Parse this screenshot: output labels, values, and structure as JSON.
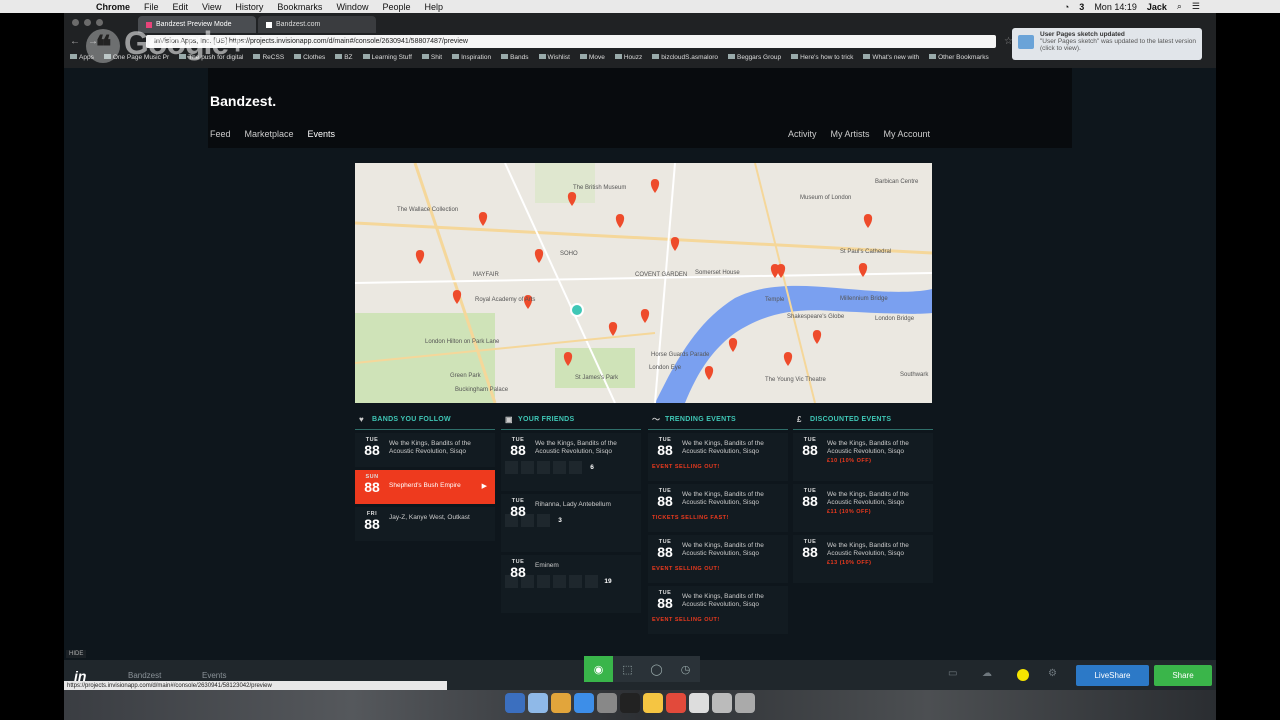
{
  "menubar": {
    "items": [
      "Chrome",
      "File",
      "Edit",
      "View",
      "History",
      "Bookmarks",
      "Window",
      "People",
      "Help"
    ],
    "clock": "Mon 14:19",
    "user": "Jack",
    "badge": "3"
  },
  "browser": {
    "tabs": [
      "Bandzest Preview Mode",
      "Bandzest.com"
    ],
    "address": "InVision Apps, Inc. [US] https://projects.invisionapp.com/d/main#/console/2630941/58807487/preview",
    "bookmarks": [
      "Apps",
      "One Page Music Pr",
      "The push for digital",
      "ReCSS",
      "Clothes",
      "BZ",
      "Learning Stuff",
      "Shit",
      "Inspiration",
      "Bands",
      "Wishlist",
      "Move",
      "Houzz",
      "bizcloudS.asmaloro",
      "Beggars Group",
      "Here's how to trick",
      "What's new with",
      "Other Bookmarks"
    ]
  },
  "overlay": {
    "gplus_text": "Google+"
  },
  "notification": {
    "title": "User Pages sketch updated",
    "body": "\"User Pages sketch\" was updated to the latest version (click to view)."
  },
  "site": {
    "logo": "Bandzest.",
    "nav_left": [
      "Feed",
      "Marketplace",
      "Events"
    ],
    "nav_right": [
      "Activity",
      "My Artists",
      "My Account"
    ]
  },
  "map_labels": [
    "The British Museum",
    "The Wallace Collection",
    "Museum of London",
    "Barbican Centre",
    "St Paul's Cathedral",
    "Millennium Bridge",
    "Shakespeare's Globe",
    "London Bridge",
    "SOHO",
    "COVENT GARDEN",
    "Somerset House",
    "MAYFAIR",
    "Royal Academy of Arts",
    "London Hilton on Park Lane",
    "Green Park",
    "Buckingham Palace",
    "St James's Park",
    "Horse Guards Parade",
    "London Eye",
    "The Young Vic Theatre",
    "Southwark",
    "Temple"
  ],
  "columns": {
    "bands": {
      "title": "BANDS YOU FOLLOW",
      "events": [
        {
          "dow": "TUE",
          "num": "88",
          "text": "We the Kings, Bandits of the Acoustic Revolution, Sisqo"
        },
        {
          "dow": "SUN",
          "num": "88",
          "text": "Shepherd's Bush Empire"
        },
        {
          "dow": "FRI",
          "num": "88",
          "text": "Jay-Z, Kanye West, Outkast"
        }
      ]
    },
    "friends": {
      "title": "YOUR FRIENDS",
      "events": [
        {
          "dow": "TUE",
          "num": "88",
          "text": "We the Kings, Bandits of the Acoustic Revolution, Sisqo",
          "count": "6"
        },
        {
          "dow": "TUE",
          "num": "88",
          "text": "Rihanna, Lady Antebellum",
          "count": "3"
        },
        {
          "dow": "TUE",
          "num": "88",
          "text": "Eminem",
          "count": "19"
        }
      ]
    },
    "trending": {
      "title": "TRENDING EVENTS",
      "events": [
        {
          "dow": "TUE",
          "num": "88",
          "text": "We the Kings, Bandits of the Acoustic Revolution, Sisqo",
          "status": "EVENT SELLING OUT!"
        },
        {
          "dow": "TUE",
          "num": "88",
          "text": "We the Kings, Bandits of the Acoustic Revolution, Sisqo",
          "status": "TICKETS SELLING FAST!"
        },
        {
          "dow": "TUE",
          "num": "88",
          "text": "We the Kings, Bandits of the Acoustic Revolution, Sisqo",
          "status": "EVENT SELLING OUT!"
        },
        {
          "dow": "TUE",
          "num": "88",
          "text": "We the Kings, Bandits of the Acoustic Revolution, Sisqo",
          "status": "EVENT SELLING OUT!"
        }
      ]
    },
    "discounted": {
      "title": "DISCOUNTED EVENTS",
      "events": [
        {
          "dow": "TUE",
          "num": "88",
          "text": "We the Kings, Bandits of the Acoustic Revolution, Sisqo",
          "status": "£10 (10% OFF)"
        },
        {
          "dow": "TUE",
          "num": "88",
          "text": "We the Kings, Bandits of the Acoustic Revolution, Sisqo",
          "status": "£11 (10% OFF)"
        },
        {
          "dow": "TUE",
          "num": "88",
          "text": "We the Kings, Bandits of the Acoustic Revolution, Sisqo",
          "status": "£13 (10% OFF)"
        }
      ]
    }
  },
  "invision": {
    "hide": "HIDE",
    "logo": "in",
    "crumbs": [
      "Bandzest",
      "Events"
    ],
    "liveshare": "LiveShare",
    "share": "Share",
    "status_url": "https://projects.invisionapp.com/d/main#/console/2630941/58123042/preview"
  },
  "colors": {
    "accent_teal": "#3fc7b6",
    "accent_red": "#ee3a1e",
    "liveshare_blue": "#2c79c7",
    "share_green": "#3ab54a"
  }
}
